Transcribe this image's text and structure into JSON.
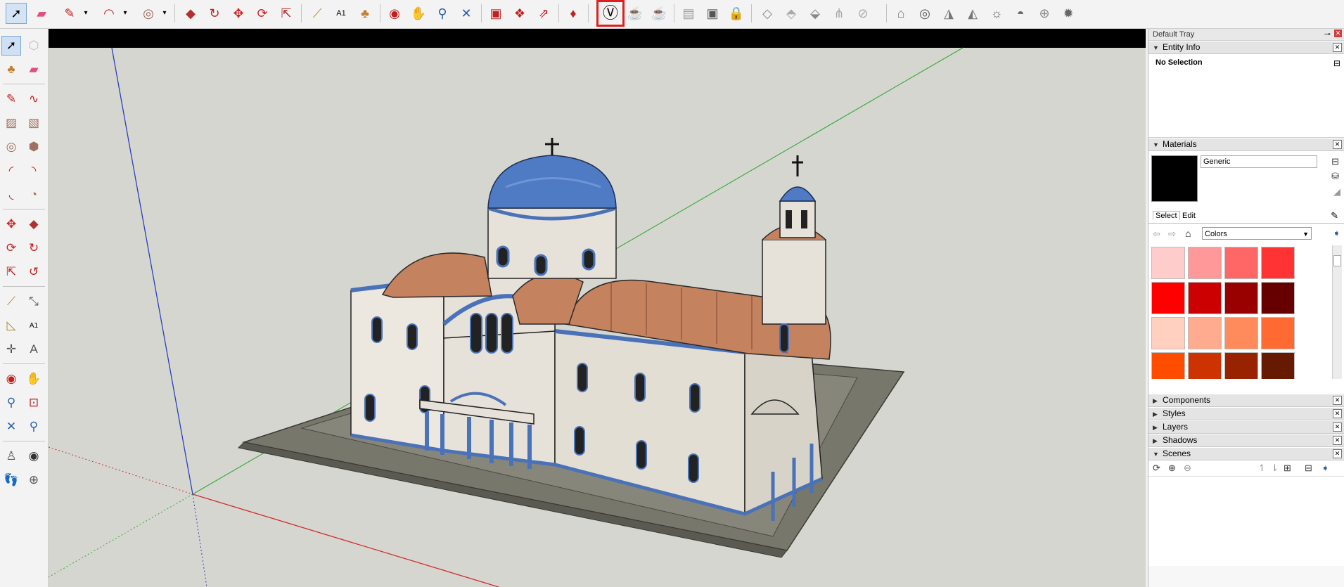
{
  "colors": {
    "viewport_bg": "#d6d6d1",
    "axis_red": "#d12b2b",
    "axis_green": "#35a835",
    "axis_blue": "#2a3fbd",
    "highlight": "#e02020"
  },
  "toolbar": {
    "icons": [
      "select-icon",
      "eraser-icon",
      "pencil-icon",
      "arc-icon",
      "circle-icon",
      "push-pull-icon",
      "follow-me-icon",
      "move-icon",
      "rotate-icon",
      "scale-icon",
      "tape-measure-icon",
      "text-icon",
      "paint-bucket-icon",
      "orbit-icon",
      "pan-icon",
      "zoom-icon",
      "zoom-extents-icon",
      "warehouse-icon",
      "extension-warehouse-icon",
      "share-model-icon",
      "ruby-icon",
      "sandbox-icon",
      "teapot-icon",
      "teapot-hand-icon",
      "section-icon",
      "section-view-icon",
      "lock-icon",
      "terrain-from-scratch-icon",
      "add-detail-icon",
      "smoove-icon",
      "stamp-icon",
      "drape-icon",
      "flip-edge-icon",
      "graduation-cap-icon",
      "wireframe-icon",
      "cone-icon",
      "lamp-icon",
      "sun-icon",
      "dome-icon",
      "globe-icon",
      "settings-gear-icon"
    ]
  },
  "tray": {
    "title": "Default Tray",
    "entity_info": {
      "header": "Entity Info",
      "selection": "No Selection"
    },
    "materials": {
      "header": "Materials",
      "material_name": "Generic",
      "current_color": "#000000",
      "tabs": [
        "Select",
        "Edit"
      ],
      "collection": "Colors",
      "swatches": [
        "#ffcccc",
        "#ff9999",
        "#ff6666",
        "#ff3333",
        "#ff0000",
        "#cc0000",
        "#990000",
        "#660000",
        "#ffd0c0",
        "#ffab8f",
        "#ff8a5c",
        "#ff6a33",
        "#ff4d00",
        "#cc3300",
        "#992200",
        "#661a00"
      ]
    },
    "collapsed_panels": [
      "Components",
      "Styles",
      "Layers",
      "Shadows"
    ],
    "scenes": {
      "header": "Scenes"
    }
  }
}
